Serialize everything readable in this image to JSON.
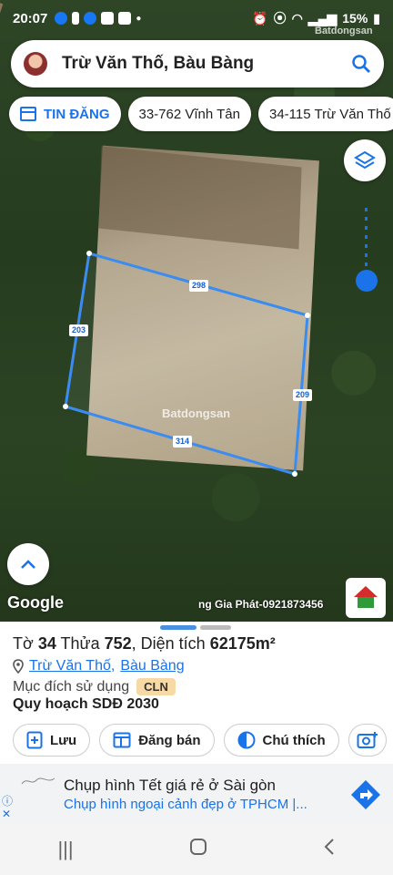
{
  "status_bar": {
    "time": "20:07",
    "battery": "15%"
  },
  "watermark_top": "Batdongsan",
  "search": {
    "title": "Trừ Văn Thố, Bàu Bàng"
  },
  "chips": [
    {
      "label": "TIN ĐĂNG",
      "active": true
    },
    {
      "label": "33-762 Vĩnh Tân",
      "active": false
    },
    {
      "label": "34-115 Trừ Văn Thố",
      "active": false
    }
  ],
  "plot": {
    "edges": {
      "top": "298",
      "left": "203",
      "right": "209",
      "bottom": "314"
    }
  },
  "watermark_center": "Batdongsan",
  "map_footer": {
    "google": "Google",
    "ad_text": "ng Gia Phát-0921873456"
  },
  "sheet": {
    "parcel_prefix": "Tờ ",
    "sheet_no": "34",
    "parcel_mid": " Thửa ",
    "parcel_no": "752",
    "area_prefix": ", Diện tích ",
    "area": "62175m²",
    "street": "Trừ Văn Thố",
    "separator": ",",
    "district": "Bàu Bàng",
    "purpose_label": "Mục đích sử dụng",
    "purpose_code": "CLN",
    "plan": "Quy hoạch SDĐ 2030",
    "actions": {
      "save": "Lưu",
      "post": "Đăng bán",
      "legend": "Chú thích"
    }
  },
  "ad": {
    "line1": "Chụp hình Tết giá rẻ ở Sài gòn",
    "line2": "Chụp hình ngoại cảnh đẹp ở TPHCM |..."
  },
  "colors": {
    "accent": "#1a73e8",
    "plot_outline": "#3b8cf0",
    "badge": "#f7d9a5"
  }
}
